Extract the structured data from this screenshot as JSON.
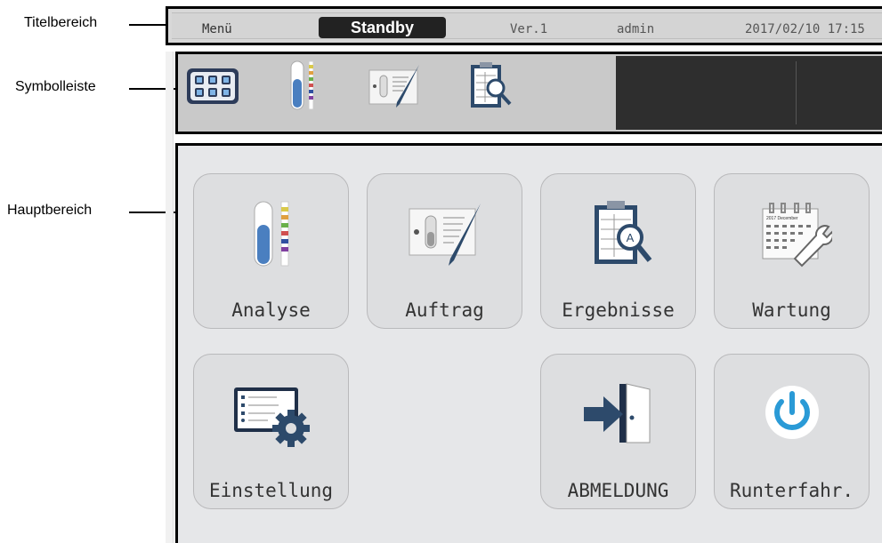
{
  "callouts": {
    "title_area": "Titelbereich",
    "toolbar": "Symbolleiste",
    "main_area": "Hauptbereich"
  },
  "titlebar": {
    "menu": "Menü",
    "status": "Standby",
    "version": "Ver.1",
    "user": "admin",
    "datetime": "2017/02/10 17:15"
  },
  "toolbar": {
    "items": [
      "main-menu-icon",
      "test-tube-icon",
      "order-form-icon",
      "results-clipboard-icon"
    ]
  },
  "tiles": [
    {
      "label": "Analyse",
      "icon": "test-tube-icon"
    },
    {
      "label": "Auftrag",
      "icon": "order-form-icon"
    },
    {
      "label": "Ergebnisse",
      "icon": "results-clipboard-icon"
    },
    {
      "label": "Wartung",
      "icon": "calendar-wrench-icon"
    },
    {
      "label": "Einstellung",
      "icon": "settings-gear-icon"
    },
    {
      "label": "ABMELDUNG",
      "icon": "logout-door-icon"
    },
    {
      "label": "Runterfahr.",
      "icon": "power-icon"
    }
  ],
  "calendar_icon_text": "2017 December",
  "colors": {
    "status_bg": "#222222",
    "tile_bg": "#dddee0",
    "icon_navy": "#2d4a6b",
    "power_blue": "#2a9ad6"
  }
}
